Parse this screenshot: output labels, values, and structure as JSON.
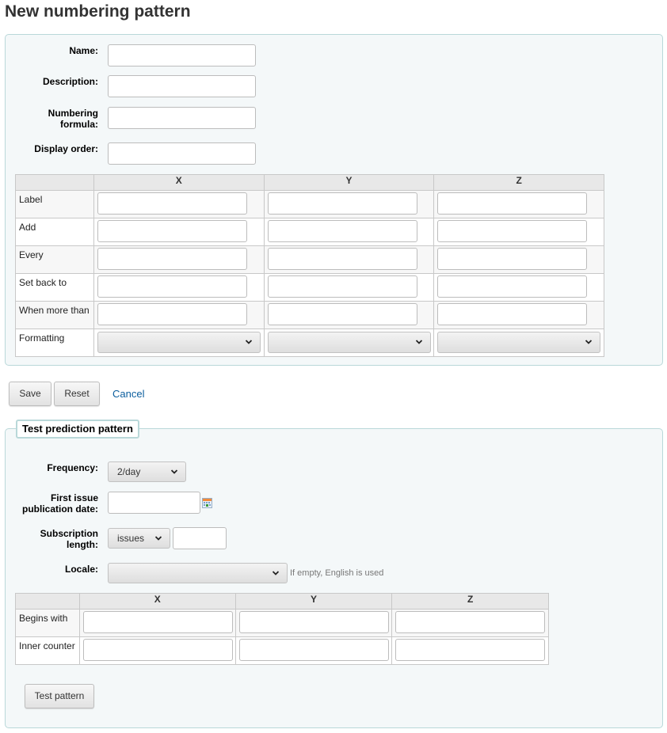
{
  "page": {
    "title": "New numbering pattern"
  },
  "pattern_form": {
    "fields": [
      {
        "label": "Name:",
        "value": ""
      },
      {
        "label": "Description:",
        "value": ""
      },
      {
        "label": "Numbering formula:",
        "label_lines": [
          "Numbering",
          "formula:"
        ],
        "value": ""
      },
      {
        "label": "Display order:",
        "value": ""
      }
    ],
    "table": {
      "columns": [
        "",
        "X",
        "Y",
        "Z"
      ],
      "rows": [
        {
          "label": "Label",
          "type": "text",
          "values": [
            "",
            "",
            ""
          ]
        },
        {
          "label": "Add",
          "type": "text",
          "values": [
            "",
            "",
            ""
          ]
        },
        {
          "label": "Every",
          "type": "text",
          "values": [
            "",
            "",
            ""
          ]
        },
        {
          "label": "Set back to",
          "type": "text",
          "values": [
            "",
            "",
            ""
          ]
        },
        {
          "label": "When more than",
          "type": "text",
          "values": [
            "",
            "",
            ""
          ]
        },
        {
          "label": "Formatting",
          "type": "select",
          "values": [
            "",
            "",
            ""
          ]
        }
      ]
    }
  },
  "actions": {
    "save": "Save",
    "reset": "Reset",
    "cancel": "Cancel"
  },
  "test_section": {
    "legend": "Test prediction pattern",
    "frequency": {
      "label": "Frequency:",
      "selected": "2/day"
    },
    "first_issue": {
      "label_lines": [
        "First issue",
        "publication date:"
      ],
      "value": "",
      "icon": "calendar-icon"
    },
    "subscription_length": {
      "label_lines": [
        "Subscription",
        "length:"
      ],
      "unit_selected": "issues",
      "value": ""
    },
    "locale": {
      "label": "Locale:",
      "selected": "",
      "hint": "If empty, English is used"
    },
    "table": {
      "columns": [
        "",
        "X",
        "Y",
        "Z"
      ],
      "rows": [
        {
          "label": "Begins with",
          "values": [
            "",
            "",
            ""
          ]
        },
        {
          "label": "Inner counter",
          "values": [
            "",
            "",
            ""
          ]
        }
      ]
    },
    "test_button": "Test pattern"
  },
  "colors": {
    "fieldset_bg": "#f4f8f9",
    "fieldset_border": "#b9d8d9",
    "link": "#0b5e9e",
    "header_bg": "#e8e8e8"
  }
}
